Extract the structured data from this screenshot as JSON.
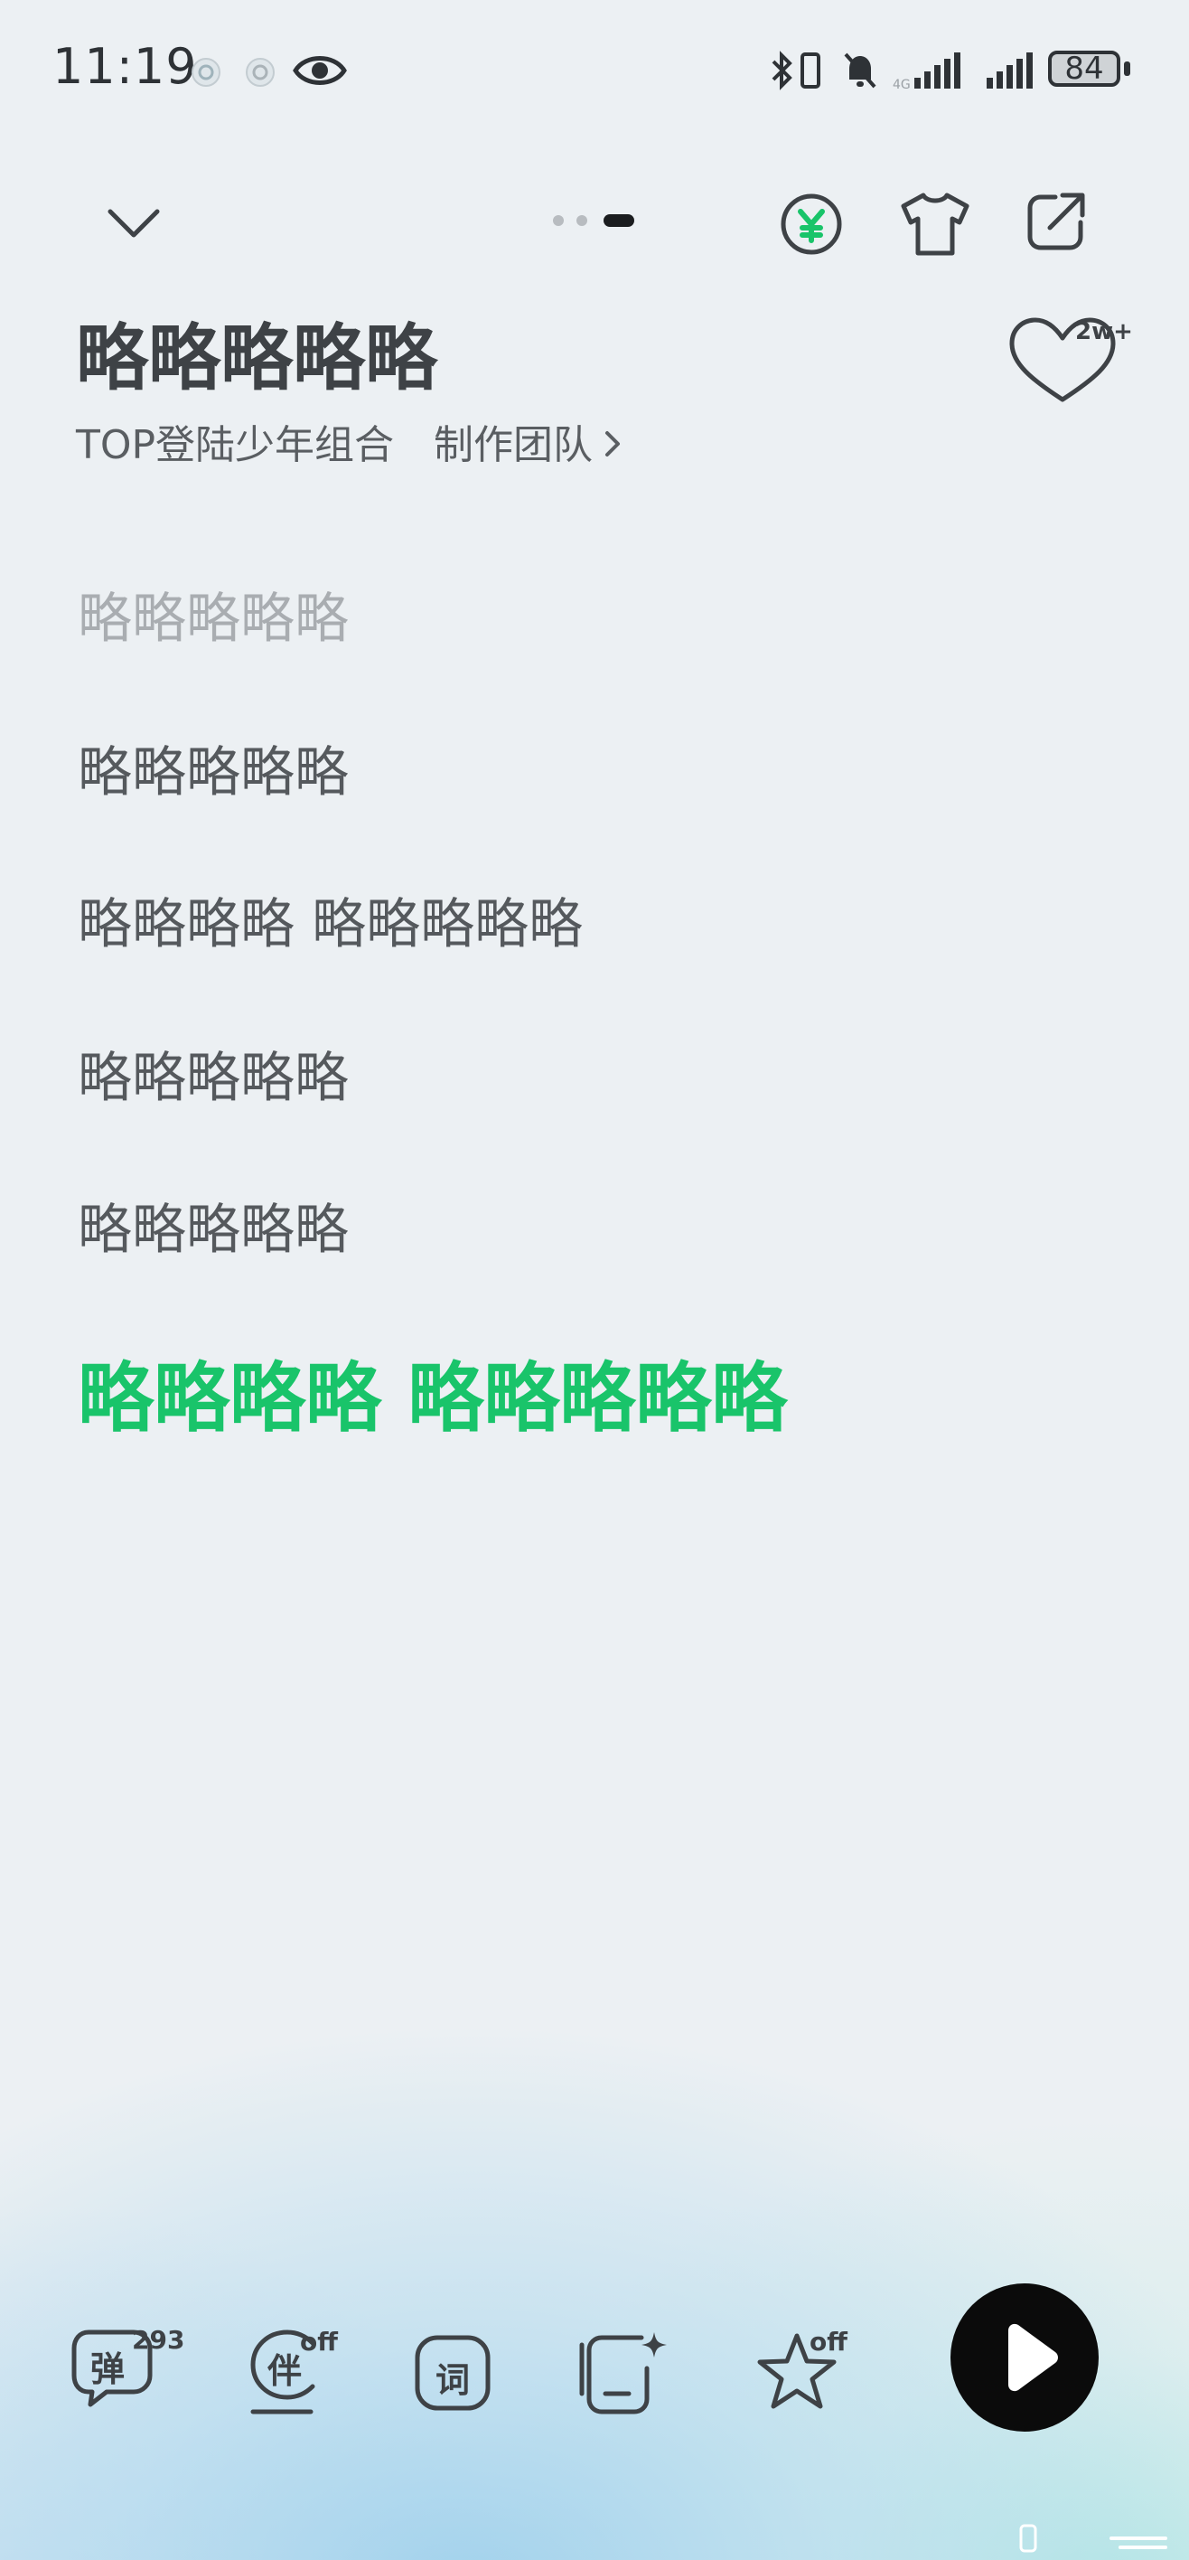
{
  "status_bar": {
    "time": "11:19",
    "battery": "84",
    "icons": [
      "app-notification-icon",
      "app-notification-icon",
      "eye-icon",
      "bluetooth-icon",
      "vibrate-icon",
      "mute-icon",
      "signal-icon",
      "signal-icon",
      "battery-icon"
    ]
  },
  "header": {
    "collapse_icon": "chevron-down-icon",
    "page_count": 3,
    "active_page": 3,
    "actions": [
      "vip-coin-icon",
      "theme-shirt-icon",
      "share-icon"
    ]
  },
  "song": {
    "title": "略略略略略",
    "artist": "TOP登陆少年组合",
    "team_label": "制作团队",
    "like_count": "2w+"
  },
  "lyrics": [
    {
      "text": "略略略略略",
      "state": "past"
    },
    {
      "text": "略略略略略",
      "state": "upcoming"
    },
    {
      "text": "略略略略 略略略略略",
      "state": "upcoming"
    },
    {
      "text": "略略略略略",
      "state": "upcoming"
    },
    {
      "text": "略略略略略",
      "state": "upcoming"
    },
    {
      "text": "略略略略 略略略略略",
      "state": "current"
    }
  ],
  "toolbar": {
    "danmaku": {
      "glyph": "弹",
      "badge": "293"
    },
    "accompany": {
      "glyph": "伴",
      "badge": "off"
    },
    "lyrics_mode": {
      "glyph": "词"
    },
    "ai_card": {
      "icon": "sparkle-card-icon"
    },
    "favorite": {
      "badge": "off"
    }
  },
  "colors": {
    "accent_green": "#19c46a",
    "text_dark": "#3e4246",
    "play_button": "#0b0b0b"
  }
}
